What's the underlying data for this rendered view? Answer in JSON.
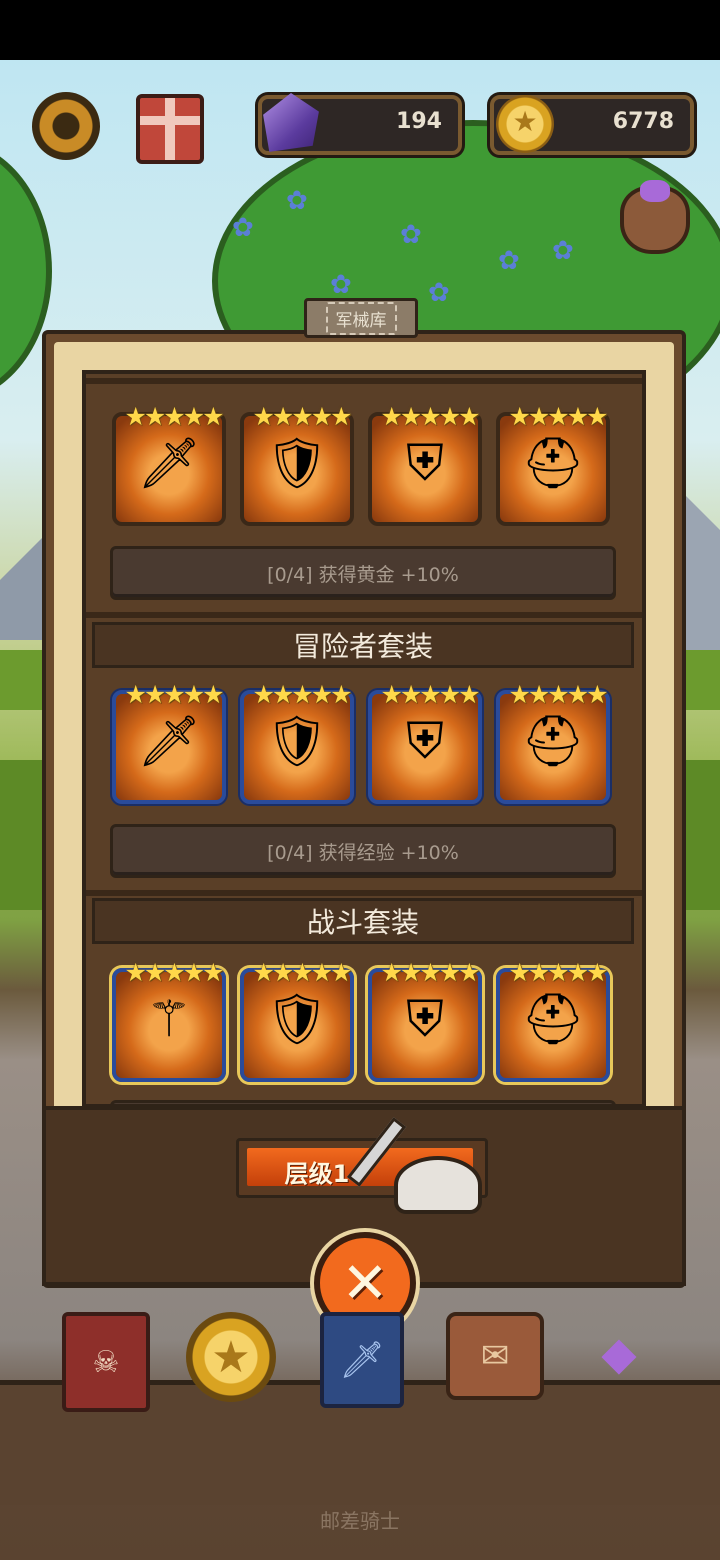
{
  "header": {
    "gems": "194",
    "gold": "6778"
  },
  "armory": {
    "title": "军械库",
    "sets": [
      {
        "name": "",
        "bonus": "[0/4] 获得黄金 +10%",
        "frame": "plain",
        "items": [
          {
            "icon": "sword",
            "stars": 5
          },
          {
            "icon": "round-shield",
            "stars": 5
          },
          {
            "icon": "plate-armor",
            "stars": 5
          },
          {
            "icon": "helmet",
            "stars": 5
          }
        ]
      },
      {
        "name": "冒险者套装",
        "bonus": "[0/4] 获得经验 +10%",
        "frame": "blue",
        "items": [
          {
            "icon": "dagger",
            "stars": 5
          },
          {
            "icon": "kite-shield",
            "stars": 5
          },
          {
            "icon": "plate-armor",
            "stars": 5
          },
          {
            "icon": "kettle-helmet",
            "stars": 5
          }
        ]
      },
      {
        "name": "战斗套装",
        "bonus": "",
        "frame": "gold",
        "items": [
          {
            "icon": "mace",
            "stars": 5
          },
          {
            "icon": "golden-shield",
            "stars": 5
          },
          {
            "icon": "golden-armor",
            "stars": 5
          },
          {
            "icon": "golden-helmet",
            "stars": 5
          }
        ]
      }
    ],
    "tier_label": "层级1"
  },
  "footer": {
    "caption": "邮差骑士"
  },
  "glyphs": {
    "star_row": "★★★★★",
    "close": "✕",
    "sword": "🗡",
    "shield": "🛡",
    "armor": "⛨",
    "helmet": "⛑",
    "mace": "⚚",
    "coin_star": "★",
    "book": "☠",
    "cards": "🗡",
    "backpack": "✉",
    "loot": "◆"
  },
  "colors": {
    "accent_orange": "#f26a1e",
    "panel_brown": "#6a4a2d",
    "parchment": "#e9d5a3",
    "star_gold": "#ffd84a",
    "blue_frame": "#2a4b9a"
  }
}
